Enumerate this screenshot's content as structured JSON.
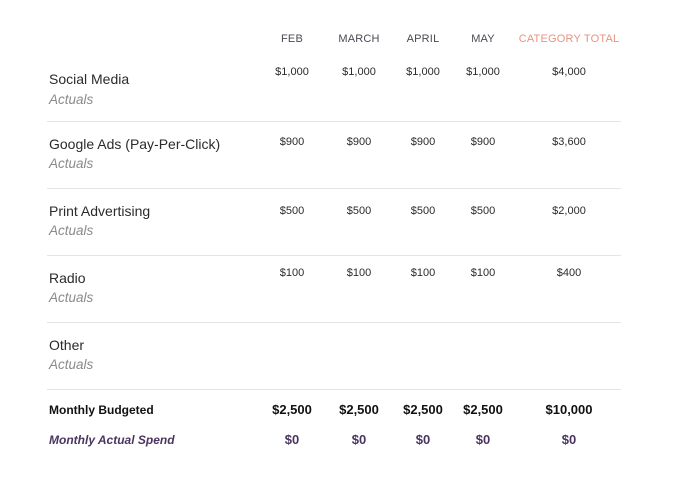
{
  "columns": [
    "FEB",
    "MARCH",
    "APRIL",
    "MAY",
    "CATEGORY TOTAL"
  ],
  "colors": {
    "category_total_header": "#e9937f",
    "actual_spend": "#4b3560",
    "muted_text": "#8a8a8a",
    "divider": "#e4e4e4"
  },
  "categories": [
    {
      "name": "Social Media",
      "sub": "Actuals",
      "values": [
        "$1,000",
        "$1,000",
        "$1,000",
        "$1,000",
        "$4,000"
      ]
    },
    {
      "name": "Google Ads (Pay-Per-Click)",
      "sub": "Actuals",
      "values": [
        "$900",
        "$900",
        "$900",
        "$900",
        "$3,600"
      ]
    },
    {
      "name": "Print Advertising",
      "sub": "Actuals",
      "values": [
        "$500",
        "$500",
        "$500",
        "$500",
        "$2,000"
      ]
    },
    {
      "name": "Radio",
      "sub": "Actuals",
      "values": [
        "$100",
        "$100",
        "$100",
        "$100",
        "$400"
      ]
    },
    {
      "name": "Other",
      "sub": "Actuals",
      "values": [
        "",
        "",
        "",
        "",
        ""
      ]
    }
  ],
  "monthly_budgeted": {
    "label": "Monthly Budgeted",
    "values": [
      "$2,500",
      "$2,500",
      "$2,500",
      "$2,500",
      "$10,000"
    ]
  },
  "monthly_actual": {
    "label": "Monthly Actual Spend",
    "values": [
      "$0",
      "$0",
      "$0",
      "$0",
      "$0"
    ]
  }
}
